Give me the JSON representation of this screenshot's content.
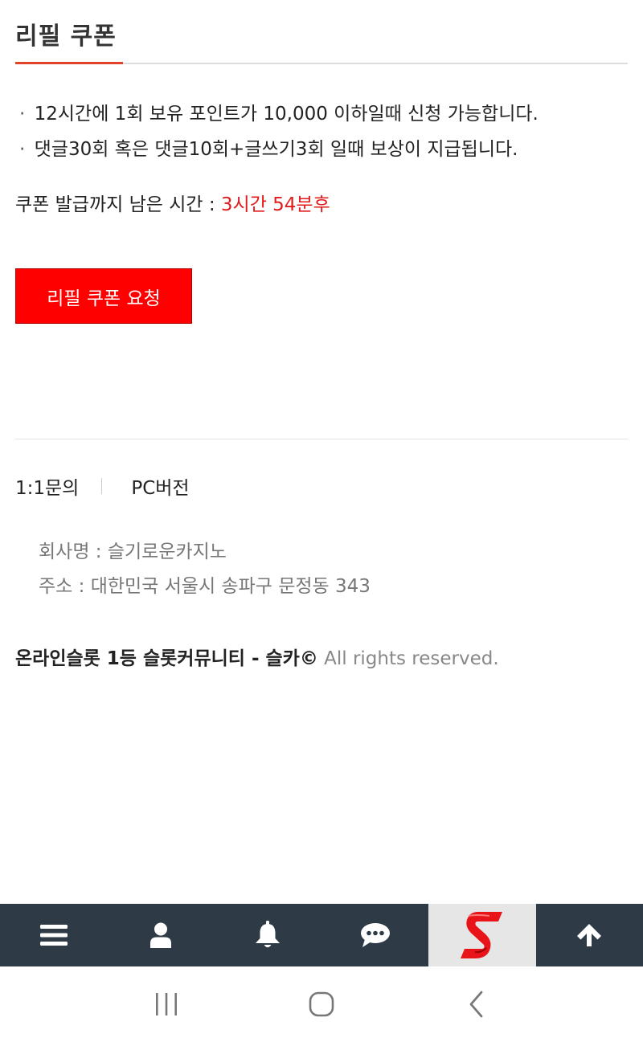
{
  "page": {
    "title": "리필 쿠폰"
  },
  "info": {
    "bullet": "·",
    "items": [
      "12시간에 1회 보유 포인트가 10,000 이하일때 신청 가능합니다.",
      "댓글30회 혹은 댓글10회+글쓰기3회 일때 보상이 지급됩니다."
    ]
  },
  "timer": {
    "label": "쿠폰 발급까지 남은 시간 : ",
    "value": "3시간 54분후"
  },
  "button": {
    "label": "리필 쿠폰 요청"
  },
  "footer": {
    "links": [
      "1:1문의",
      "PC버전"
    ],
    "company_name": "회사명 : 슬기로운카지노",
    "address": "주소 : 대한민국 서울시 송파구 문정동 343",
    "copyright_brand": "온라인슬롯 1등 슬롯커뮤니티 - 슬카©",
    "copyright_rest": " All rights reserved."
  },
  "bottom_nav": {
    "icons": [
      "menu-icon",
      "user-icon",
      "bell-icon",
      "chat-icon",
      "site-logo",
      "arrow-up-icon"
    ]
  },
  "colors": {
    "accent": "#e0432a",
    "button": "#ff0000",
    "timer": "#e11b1b",
    "nav_bg": "#2e3a46"
  }
}
